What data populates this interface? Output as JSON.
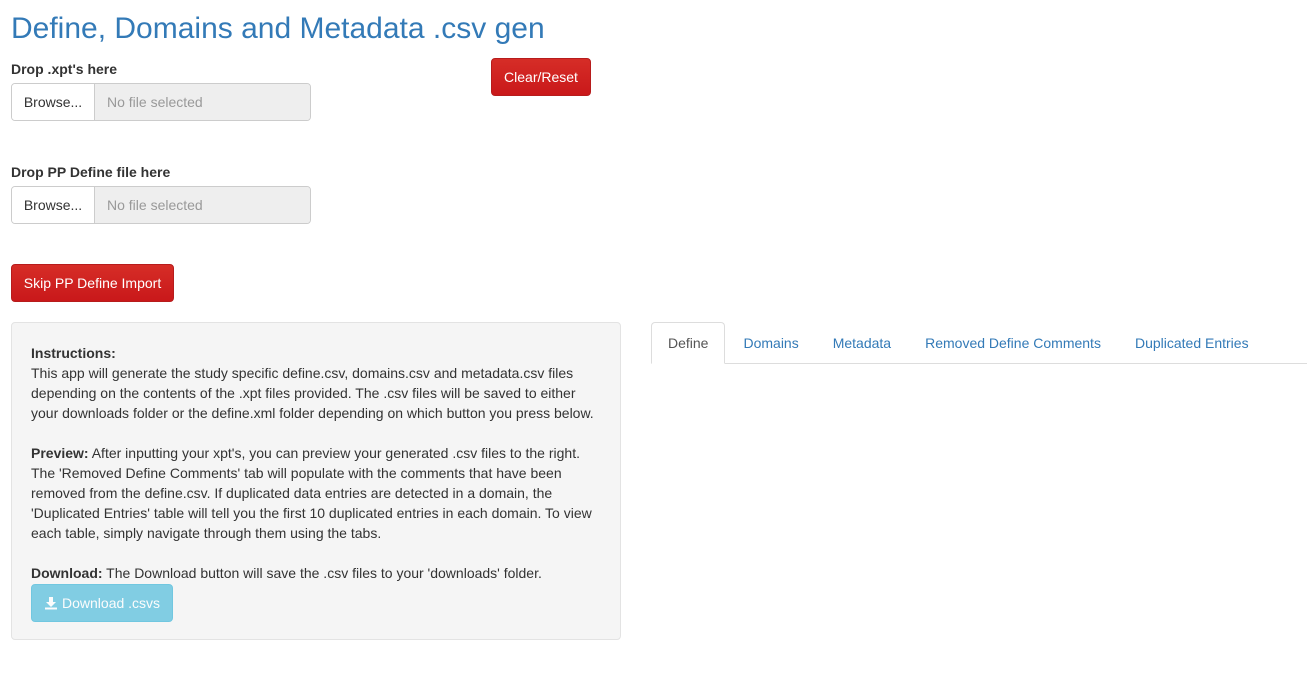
{
  "title": "Define, Domains and Metadata .csv gen",
  "xpt_input": {
    "label": "Drop .xpt's here",
    "browse_label": "Browse...",
    "placeholder": "No file selected"
  },
  "define_input": {
    "label": "Drop PP Define file here",
    "browse_label": "Browse...",
    "placeholder": "No file selected"
  },
  "buttons": {
    "clear_reset": "Clear/Reset",
    "skip_import": "Skip PP Define Import",
    "download": "Download .csvs"
  },
  "instructions": {
    "instructions_heading": "Instructions:",
    "instructions_text": "This app will generate the study specific define.csv, domains.csv and metadata.csv files depending on the contents of the .xpt files provided. The .csv files will be saved to either your downloads folder or the define.xml folder depending on which button you press below.",
    "preview_heading": "Preview:",
    "preview_text": " After inputting your xpt's, you can preview your generated .csv files to the right. The 'Removed Define Comments' tab will populate with the comments that have been removed from the define.csv. If duplicated data entries are detected in a domain, the 'Duplicated Entries' table will tell you the first 10 duplicated entries in each domain. To view each table, simply navigate through them using the tabs.",
    "download_heading": "Download:",
    "download_text": " The Download button will save the .csv files to your 'downloads' folder."
  },
  "tabs": [
    {
      "label": "Define",
      "active": true
    },
    {
      "label": "Domains",
      "active": false
    },
    {
      "label": "Metadata",
      "active": false
    },
    {
      "label": "Removed Define Comments",
      "active": false
    },
    {
      "label": "Duplicated Entries",
      "active": false
    }
  ],
  "colors": {
    "title": "#337ab7",
    "danger": "#d9231e",
    "info": "#5bc0de",
    "link": "#337ab7"
  },
  "icons": {
    "download": "download-icon"
  }
}
